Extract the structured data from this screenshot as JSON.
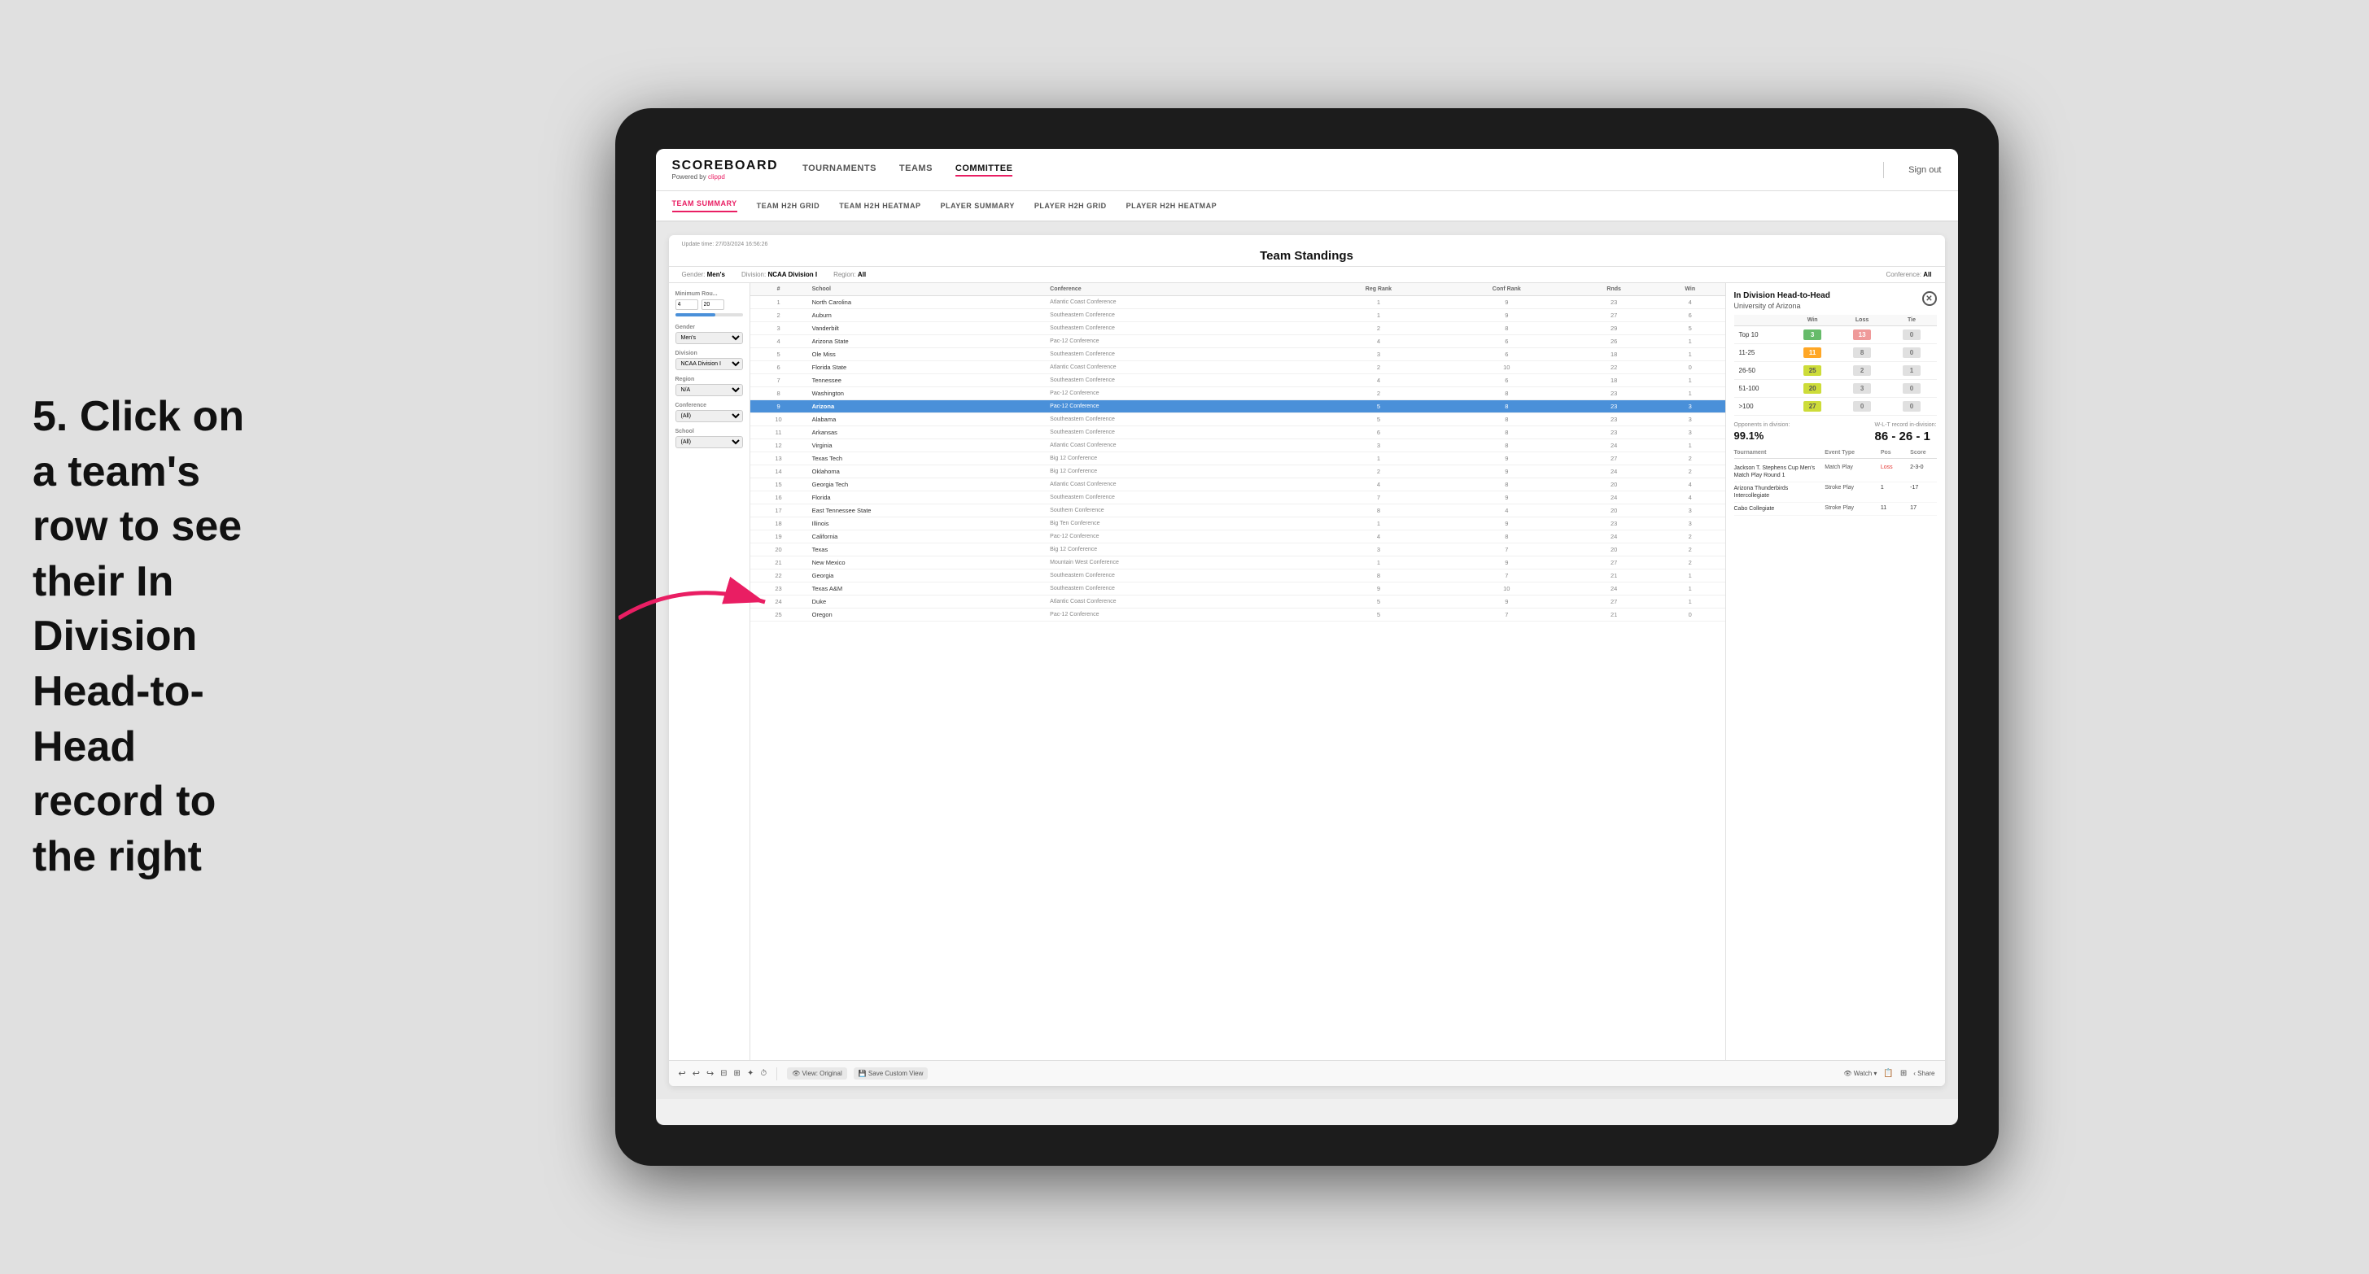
{
  "instruction": {
    "text": "5. Click on a team's row to see their In Division Head-to-Head record to the right"
  },
  "nav": {
    "logo": "SCOREBOARD",
    "logo_sub": "Powered by clippd",
    "links": [
      "TOURNAMENTS",
      "TEAMS",
      "COMMITTEE"
    ],
    "active_link": "COMMITTEE",
    "sign_out": "Sign out",
    "sub_links": [
      "TEAM SUMMARY",
      "TEAM H2H GRID",
      "TEAM H2H HEATMAP",
      "PLAYER SUMMARY",
      "PLAYER H2H GRID",
      "PLAYER H2H HEATMAP"
    ],
    "active_sub": "PLAYER SUMMARY"
  },
  "panel": {
    "update_time": "Update time: 27/03/2024 16:56:26",
    "title": "Team Standings",
    "gender_label": "Gender:",
    "gender_value": "Men's",
    "division_label": "Division:",
    "division_value": "NCAA Division I",
    "region_label": "Region:",
    "region_value": "All",
    "conference_label": "Conference:",
    "conference_value": "All"
  },
  "sidebar": {
    "min_rounds_label": "Minimum Rou...",
    "min_rounds_val": "4",
    "min_rounds_max": "20",
    "gender_label": "Gender",
    "gender_value": "Men's",
    "division_label": "Division",
    "division_value": "NCAA Division I",
    "region_label": "Region",
    "region_value": "N/A",
    "conference_label": "Conference",
    "conference_value": "(All)",
    "school_label": "School",
    "school_value": "(All)"
  },
  "table": {
    "headers": [
      "#",
      "School",
      "Conference",
      "Reg Rank",
      "Conf Rank",
      "Rnds",
      "Win"
    ],
    "rows": [
      {
        "rank": 1,
        "school": "North Carolina",
        "conference": "Atlantic Coast Conference",
        "reg_rank": 1,
        "conf_rank": 9,
        "rnds": 23,
        "win": 4
      },
      {
        "rank": 2,
        "school": "Auburn",
        "conference": "Southeastern Conference",
        "reg_rank": 1,
        "conf_rank": 9,
        "rnds": 27,
        "win": 6
      },
      {
        "rank": 3,
        "school": "Vanderbilt",
        "conference": "Southeastern Conference",
        "reg_rank": 2,
        "conf_rank": 8,
        "rnds": 29,
        "win": 5
      },
      {
        "rank": 4,
        "school": "Arizona State",
        "conference": "Pac-12 Conference",
        "reg_rank": 4,
        "conf_rank": 6,
        "rnds": 26,
        "win": 1
      },
      {
        "rank": 5,
        "school": "Ole Miss",
        "conference": "Southeastern Conference",
        "reg_rank": 3,
        "conf_rank": 6,
        "rnds": 18,
        "win": 1
      },
      {
        "rank": 6,
        "school": "Florida State",
        "conference": "Atlantic Coast Conference",
        "reg_rank": 2,
        "conf_rank": 10,
        "rnds": 22,
        "win": 0
      },
      {
        "rank": 7,
        "school": "Tennessee",
        "conference": "Southeastern Conference",
        "reg_rank": 4,
        "conf_rank": 6,
        "rnds": 18,
        "win": 1
      },
      {
        "rank": 8,
        "school": "Washington",
        "conference": "Pac-12 Conference",
        "reg_rank": 2,
        "conf_rank": 8,
        "rnds": 23,
        "win": 1
      },
      {
        "rank": 9,
        "school": "Arizona",
        "conference": "Pac-12 Conference",
        "reg_rank": 5,
        "conf_rank": 8,
        "rnds": 23,
        "win": 3,
        "selected": true
      },
      {
        "rank": 10,
        "school": "Alabama",
        "conference": "Southeastern Conference",
        "reg_rank": 5,
        "conf_rank": 8,
        "rnds": 23,
        "win": 3
      },
      {
        "rank": 11,
        "school": "Arkansas",
        "conference": "Southeastern Conference",
        "reg_rank": 6,
        "conf_rank": 8,
        "rnds": 23,
        "win": 3
      },
      {
        "rank": 12,
        "school": "Virginia",
        "conference": "Atlantic Coast Conference",
        "reg_rank": 3,
        "conf_rank": 8,
        "rnds": 24,
        "win": 1
      },
      {
        "rank": 13,
        "school": "Texas Tech",
        "conference": "Big 12 Conference",
        "reg_rank": 1,
        "conf_rank": 9,
        "rnds": 27,
        "win": 2
      },
      {
        "rank": 14,
        "school": "Oklahoma",
        "conference": "Big 12 Conference",
        "reg_rank": 2,
        "conf_rank": 9,
        "rnds": 24,
        "win": 2
      },
      {
        "rank": 15,
        "school": "Georgia Tech",
        "conference": "Atlantic Coast Conference",
        "reg_rank": 4,
        "conf_rank": 8,
        "rnds": 20,
        "win": 4
      },
      {
        "rank": 16,
        "school": "Florida",
        "conference": "Southeastern Conference",
        "reg_rank": 7,
        "conf_rank": 9,
        "rnds": 24,
        "win": 4
      },
      {
        "rank": 17,
        "school": "East Tennessee State",
        "conference": "Southern Conference",
        "reg_rank": 8,
        "conf_rank": 4,
        "rnds": 20,
        "win": 3
      },
      {
        "rank": 18,
        "school": "Illinois",
        "conference": "Big Ten Conference",
        "reg_rank": 1,
        "conf_rank": 9,
        "rnds": 23,
        "win": 3
      },
      {
        "rank": 19,
        "school": "California",
        "conference": "Pac-12 Conference",
        "reg_rank": 4,
        "conf_rank": 8,
        "rnds": 24,
        "win": 2
      },
      {
        "rank": 20,
        "school": "Texas",
        "conference": "Big 12 Conference",
        "reg_rank": 3,
        "conf_rank": 7,
        "rnds": 20,
        "win": 2
      },
      {
        "rank": 21,
        "school": "New Mexico",
        "conference": "Mountain West Conference",
        "reg_rank": 1,
        "conf_rank": 9,
        "rnds": 27,
        "win": 2
      },
      {
        "rank": 22,
        "school": "Georgia",
        "conference": "Southeastern Conference",
        "reg_rank": 8,
        "conf_rank": 7,
        "rnds": 21,
        "win": 1
      },
      {
        "rank": 23,
        "school": "Texas A&M",
        "conference": "Southeastern Conference",
        "reg_rank": 9,
        "conf_rank": 10,
        "rnds": 24,
        "win": 1
      },
      {
        "rank": 24,
        "school": "Duke",
        "conference": "Atlantic Coast Conference",
        "reg_rank": 5,
        "conf_rank": 9,
        "rnds": 27,
        "win": 1
      },
      {
        "rank": 25,
        "school": "Oregon",
        "conference": "Pac-12 Conference",
        "reg_rank": 5,
        "conf_rank": 7,
        "rnds": 21,
        "win": 0
      }
    ]
  },
  "h2h": {
    "title": "In Division Head-to-Head",
    "team": "University of Arizona",
    "win_header": "Win",
    "loss_header": "Loss",
    "tie_header": "Tie",
    "rows": [
      {
        "range": "Top 10",
        "win": 3,
        "loss": 13,
        "tie": 0,
        "win_color": "green",
        "loss_color": "red",
        "tie_color": "zero"
      },
      {
        "range": "11-25",
        "win": 11,
        "loss": 8,
        "tie": 0,
        "win_color": "orange",
        "loss_color": "zero",
        "tie_color": "zero"
      },
      {
        "range": "26-50",
        "win": 25,
        "loss": 2,
        "tie": 1,
        "win_color": "lime",
        "loss_color": "zero",
        "tie_color": "zero"
      },
      {
        "range": "51-100",
        "win": 20,
        "loss": 3,
        "tie": 0,
        "win_color": "lime",
        "loss_color": "zero",
        "tie_color": "zero"
      },
      {
        "range": ">100",
        "win": 27,
        "loss": 0,
        "tie": 0,
        "win_color": "lime",
        "loss_color": "zero",
        "tie_color": "zero"
      }
    ],
    "opponents_pct_label": "Opponents in division:",
    "opponents_pct": "99.1%",
    "wlt_label": "W-L-T record in-division:",
    "wlt": "86 - 26 - 1",
    "tournaments_header": [
      "Tournament",
      "Event Type",
      "Pos",
      "Score"
    ],
    "tournaments": [
      {
        "name": "Jackson T. Stephens Cup Men's Match Play Round 1",
        "event_type": "Match Play",
        "pos": "Loss",
        "score": "2-3-0",
        "pos_class": "loss"
      },
      {
        "name": "Arizona Thunderbirds Intercollegiate",
        "event_type": "Stroke Play",
        "pos": "1",
        "score": "-17",
        "pos_class": ""
      },
      {
        "name": "Cabo Collegiate",
        "event_type": "Stroke Play",
        "pos": "11",
        "score": "17",
        "pos_class": ""
      }
    ]
  },
  "toolbar": {
    "buttons": [
      "↩",
      "↪",
      "⟳",
      "⊟",
      "⊞",
      "✦",
      "⏱",
      "View: Original",
      "Save Custom View"
    ],
    "right_buttons": [
      "👁 Watch",
      "📋",
      "☰",
      "< Share"
    ]
  }
}
